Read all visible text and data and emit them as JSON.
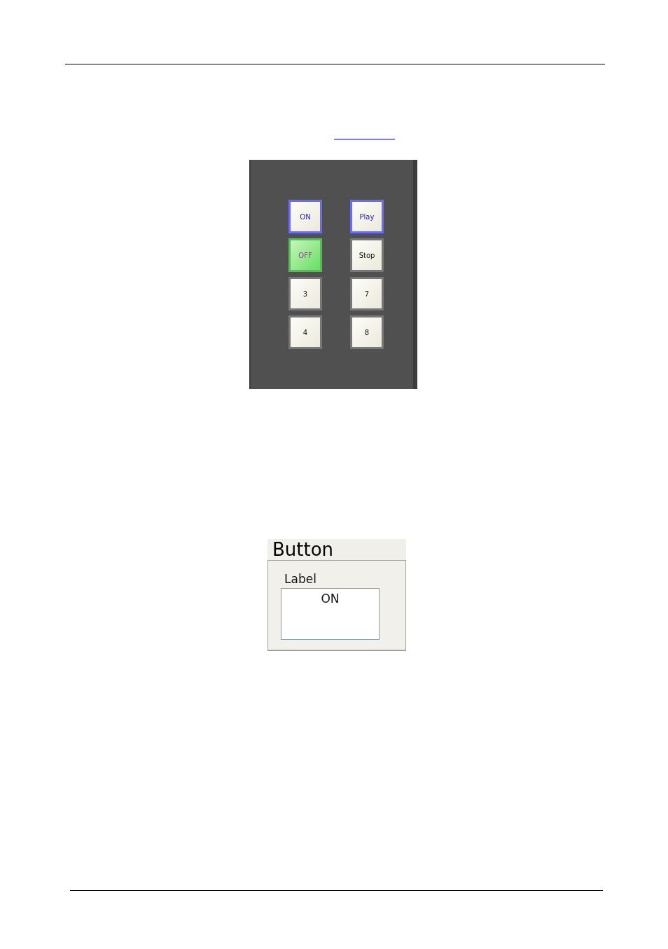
{
  "keypad": {
    "columns": [
      {
        "buttons": [
          {
            "label": "ON",
            "selected": true,
            "on": false
          },
          {
            "label": "OFF",
            "selected": false,
            "on": true
          },
          {
            "label": "3",
            "selected": false,
            "on": false
          },
          {
            "label": "4",
            "selected": false,
            "on": false
          }
        ]
      },
      {
        "buttons": [
          {
            "label": "Play",
            "selected": true,
            "on": false
          },
          {
            "label": "Stop",
            "selected": false,
            "on": false
          },
          {
            "label": "7",
            "selected": false,
            "on": false
          },
          {
            "label": "8",
            "selected": false,
            "on": false
          }
        ]
      }
    ]
  },
  "properties": {
    "title": "Button",
    "field_label": "Label",
    "field_value": "ON"
  }
}
